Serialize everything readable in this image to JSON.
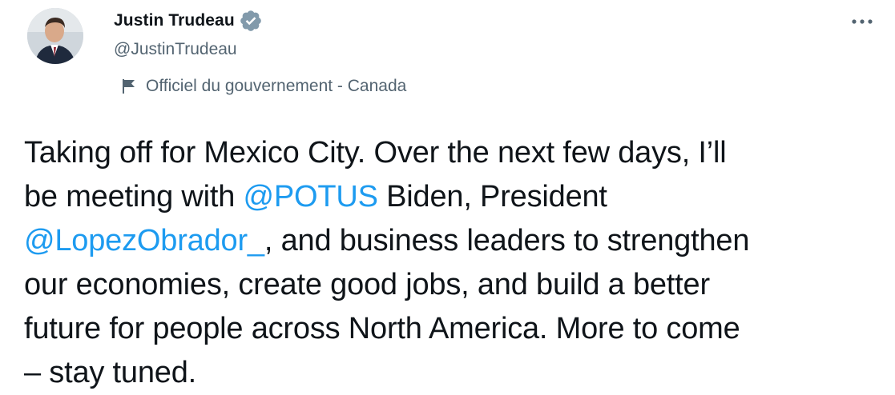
{
  "author": {
    "display_name": "Justin Trudeau",
    "handle": "@JustinTrudeau",
    "verified": true,
    "label": "Officiel du gouvernement - Canada",
    "avatar_icon": "profile-photo"
  },
  "tweet": {
    "lines": [
      [
        {
          "text": "Taking off for Mexico City. Over the next few days, I’ll"
        }
      ],
      [
        {
          "text": "be meeting with "
        },
        {
          "text": "@POTUS",
          "mention": true
        },
        {
          "text": " Biden, President"
        }
      ],
      [
        {
          "text": "@LopezObrador_",
          "mention": true
        },
        {
          "text": ", and business leaders to strengthen"
        }
      ],
      [
        {
          "text": "our economies, create good jobs, and build a better"
        }
      ],
      [
        {
          "text": "future for people across North America. More to come"
        }
      ],
      [
        {
          "text": "– stay tuned."
        }
      ]
    ]
  },
  "icons": {
    "verified": "verified-badge-icon",
    "flag": "flag-icon",
    "more": "more-options-icon"
  },
  "colors": {
    "text": "#0f1419",
    "secondary": "#536471",
    "mention": "#1d9bf0",
    "verified_badge": "#829aab"
  }
}
